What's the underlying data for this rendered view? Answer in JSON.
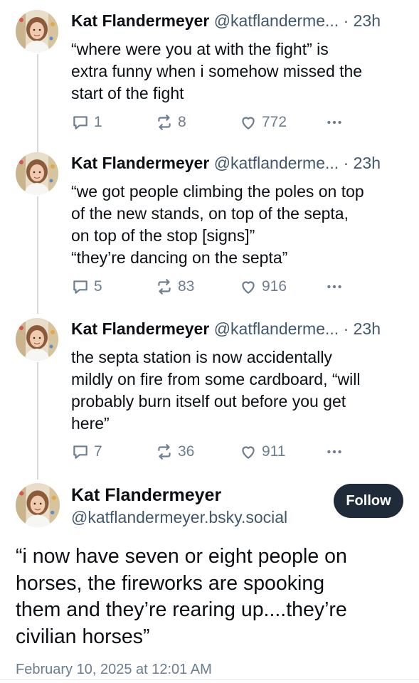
{
  "thread": [
    {
      "author_name": "Kat Flandermeyer",
      "author_handle": "@katflanderme...",
      "time": "· 23h",
      "text_lines": [
        "“where were you at with the fight” is",
        "extra funny when i somehow missed the",
        "start of the fight"
      ],
      "replies": "1",
      "reposts": "8",
      "likes": "772"
    },
    {
      "author_name": "Kat Flandermeyer",
      "author_handle": "@katflanderme...",
      "time": "· 23h",
      "text_lines": [
        "“we got people climbing the poles on top",
        "of the new stands, on top of the septa,",
        "on top of the stop [signs]”",
        "“they’re dancing on the septa”"
      ],
      "replies": "5",
      "reposts": "83",
      "likes": "916"
    },
    {
      "author_name": "Kat Flandermeyer",
      "author_handle": "@katflanderme...",
      "time": "· 23h",
      "text_lines": [
        "the septa station is now accidentally",
        "mildly on fire from some cardboard, “will",
        "probably burn itself out before you get",
        "here”"
      ],
      "replies": "7",
      "reposts": "36",
      "likes": "911"
    }
  ],
  "main_post": {
    "author_name": "Kat Flandermeyer",
    "author_handle": "@katflandermeyer.bsky.social",
    "follow_label": "Follow",
    "text_lines": [
      "“i now have seven or eight people on",
      "horses, the fireworks are spooking",
      "them and they’re rearing up....they’re",
      "civilian horses”"
    ],
    "timestamp": "February 10, 2025 at 12:01 AM"
  },
  "icons": {
    "reply": "speech-bubble-icon",
    "repost": "repost-arrows-icon",
    "like": "heart-icon",
    "more": "ellipsis-icon"
  },
  "colors": {
    "follow_button": "#1f2b38",
    "muted_text": "#42576c",
    "action_icons": "#6b7d8e",
    "thread_line": "#d4d9df"
  }
}
